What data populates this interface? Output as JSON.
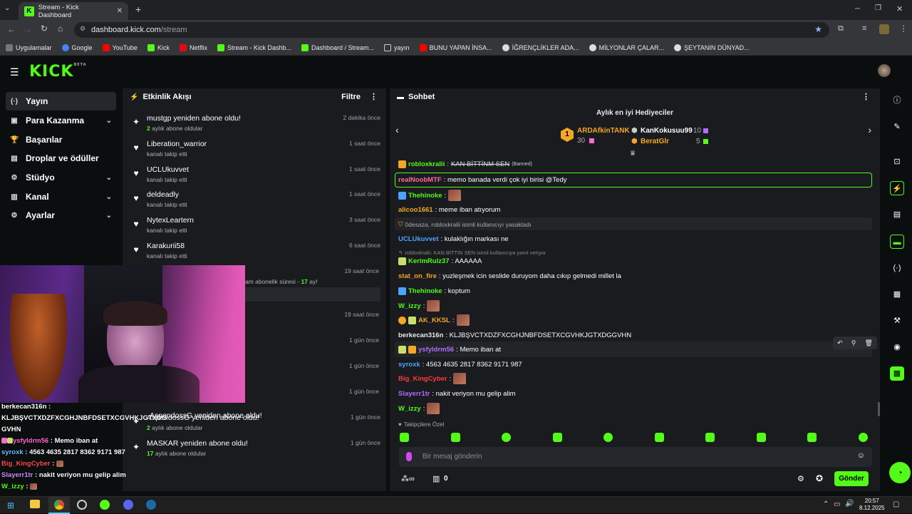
{
  "browser": {
    "tab_title": "Stream - Kick Dashboard",
    "url_host": "dashboard.kick.com",
    "url_path": "/stream",
    "bookmarks": [
      "Uygulamalar",
      "Google",
      "YouTube",
      "Kick",
      "Netflix",
      "Stream - Kick Dashb...",
      "Dashboard / Stream...",
      "yayın",
      "BUNU YAPAN İNSA...",
      "İĞRENÇLİKLER ADA...",
      "MİLYONLAR ÇALAR...",
      "ŞEYTANIN DÜNYAD..."
    ]
  },
  "logo": {
    "text": "KICK",
    "beta": "BETA"
  },
  "nav": [
    {
      "label": "Yayın",
      "icon": "stream-icon",
      "glyph": "(·)"
    },
    {
      "label": "Para Kazanma",
      "icon": "money-icon",
      "glyph": "▣"
    },
    {
      "label": "Başarılar",
      "icon": "trophy-icon",
      "glyph": "🏆"
    },
    {
      "label": "Droplar ve ödüller",
      "icon": "gift-icon",
      "glyph": "▤"
    },
    {
      "label": "Stüdyo",
      "icon": "studio-icon",
      "glyph": "⚙"
    },
    {
      "label": "Kanal",
      "icon": "channel-icon",
      "glyph": "▥"
    },
    {
      "label": "Ayarlar",
      "icon": "settings-icon",
      "glyph": "⚙"
    }
  ],
  "activity": {
    "title": "Etkinlik Akışı",
    "filter": "Filtre",
    "events": [
      {
        "title": "mustgp yeniden abone oldu!",
        "sub_num": "2",
        "sub": "aylık abone oldular",
        "time": "2 dakika önce",
        "icon": "sparkle-icon",
        "glyph": "✦"
      },
      {
        "title": "Liberation_warrior",
        "sub_num": "",
        "sub": "kanalı takip etti",
        "time": "1 saat önce",
        "icon": "heart-icon",
        "glyph": "♥"
      },
      {
        "title": "UCLUkuvvet",
        "sub_num": "",
        "sub": "kanalı takip etti",
        "time": "1 saat önce",
        "icon": "heart-icon",
        "glyph": "♥"
      },
      {
        "title": "deldeadly",
        "sub_num": "",
        "sub": "kanalı takip etti",
        "time": "1 saat önce",
        "icon": "heart-icon",
        "glyph": "♥"
      },
      {
        "title": "NytexLeartern",
        "sub_num": "",
        "sub": "kanalı takip etti",
        "time": "3 saat önce",
        "icon": "heart-icon",
        "glyph": "♥"
      },
      {
        "title": "Karakurii58",
        "sub_num": "",
        "sub": "kanalı takip etti",
        "time": "6 saat önce",
        "icon": "heart-icon",
        "glyph": "♥"
      }
    ],
    "partial_sub": "am abonelik süresi -",
    "partial_num": "17",
    "partial_tail": "ay!",
    "hidden_times": [
      "19 saat önce",
      "19 saat önce",
      "1 gün önce",
      "1 gün önce",
      "1 gün önce"
    ],
    "lower_events": [
      {
        "title": "AspendossG yeniden abone oldu!",
        "sub_num": "2",
        "sub": "aylık abone oldular",
        "time": "1 gün önce"
      },
      {
        "title": "MASKAR yeniden abone oldu!",
        "sub_num": "17",
        "sub": "aylık abone oldular",
        "time": "1 gün önce"
      }
    ],
    "overlay_title": "AspendossG yeniden abone oldu!"
  },
  "chat": {
    "title": "Sohbet",
    "gifters_title": "Aylık en iyi Hediyeciler",
    "gifters": [
      {
        "rank": "1",
        "name": "ARDAfkinTANK",
        "count": "30"
      },
      {
        "name": "KanKokusuu99",
        "count": "10"
      },
      {
        "name": "BeratGlr",
        "count": "5"
      }
    ],
    "messages": [
      {
        "user": "robloxkralii",
        "text": "KAN BİTTİNM SEN",
        "tag": "(Banned)",
        "color": "#53fc18"
      },
      {
        "user": "realNoobMTF",
        "text": ": memo banada verdi çok iyi birisi @Tedy",
        "color": "#ff6b9d"
      },
      {
        "user": "Thehinoke",
        "text": ":",
        "color": "#53fc18"
      },
      {
        "user": "alicoo1661",
        "text": ": meme iban atıyorum",
        "color": "#f5a623"
      },
      {
        "sys": "0desaza, robloxkralii isimli kullanıcıyı yasakladı"
      },
      {
        "user": "UCLUkuvvet",
        "text": ": kulaklığın markası ne",
        "color": "#4da3ff"
      },
      {
        "reply": "robloxkralii: KAN BİTTİN SEN isimli kullanıcıya yanıt veriyor"
      },
      {
        "user": "KerimRulz37",
        "text": ": AAAAAA",
        "color": "#53fc18"
      },
      {
        "user": "stat_on_fire",
        "text": ": yuzleşmek icin seslide duruyom daha cıkıp gelmedi millet la",
        "color": "#f5a623"
      },
      {
        "user": "Thehinoke",
        "text": ": koptum",
        "color": "#53fc18"
      },
      {
        "user": "W_izzy",
        "text": ":",
        "color": "#53fc18"
      },
      {
        "user": "AK_KKSL",
        "text": ":",
        "color": "#f5a623"
      },
      {
        "user": "berkecan316n",
        "text": ": KLJBŞVCTXDZFXCGHJNBFDSETXCGVHKJGTXDGGVHN",
        "color": "#e8eaed"
      },
      {
        "user": "ysfyldrm56",
        "text": ": Memo iban at",
        "color": "#b36bff"
      },
      {
        "user": "syroxk",
        "text": ": 4563 4635 2817 8362 9171 987",
        "color": "#4da3ff"
      },
      {
        "user": "Big_KingCyber",
        "text": ":",
        "color": "#ff3b3b"
      },
      {
        "user": "Slayerr1tr",
        "text": ": nakit veriyon mu gelip alim",
        "color": "#b36bff"
      },
      {
        "user": "W_izzy",
        "text": ":",
        "color": "#53fc18"
      }
    ],
    "followers_only": "Takipçilere Özel",
    "input_placeholder": "Bir mesaj gönderin",
    "send": "Gönder",
    "points": "0"
  },
  "overlay_chat": [
    {
      "user": "berkecan316n",
      "text": " :",
      "color": "#ffffff"
    },
    {
      "line": "KLJBŞVCTXDZFXCGHJNBFDSETXCGVHKJGTXDG"
    },
    {
      "line": "GVHN"
    },
    {
      "user": "ysfyldrm56",
      "text": " : Memo iban at",
      "color": "#ff6bcb"
    },
    {
      "user": "syroxk",
      "text": " : 4563 4635 2817 8362 9171 987",
      "color": "#6fb8ff"
    },
    {
      "user": "Big_KingCyber",
      "text": " :",
      "color": "#ff4b4b"
    },
    {
      "user": "Slayerr1tr",
      "text": " : nakit veriyon mu gelip alim",
      "color": "#d38bff"
    },
    {
      "user": "W_izzy",
      "text": " :",
      "color": "#53fc18"
    }
  ],
  "taskbar": {
    "time": "20:57",
    "date": "8.12.2025"
  }
}
